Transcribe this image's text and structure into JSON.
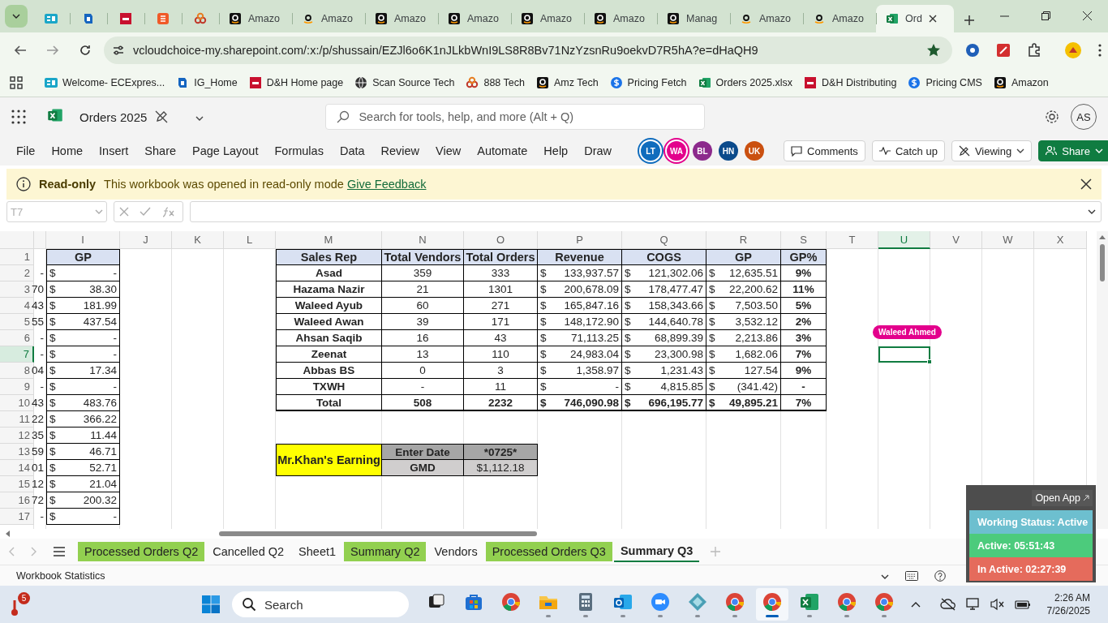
{
  "browser": {
    "tabs": [
      {
        "kind": "ec",
        "selected": false
      },
      {
        "kind": "blue",
        "selected": false
      },
      {
        "kind": "dh",
        "selected": false
      },
      {
        "kind": "s",
        "selected": false
      },
      {
        "kind": "rings",
        "selected": false
      },
      {
        "kind": "amazon-dark",
        "label": "Amazo",
        "selected": false
      },
      {
        "kind": "amazon-light",
        "label": "Amazo",
        "selected": false
      },
      {
        "kind": "amazon-dark",
        "label": "Amazo",
        "selected": false
      },
      {
        "kind": "amazon-dark",
        "label": "Amazo",
        "selected": false
      },
      {
        "kind": "amazon-dark",
        "label": "Amazo",
        "selected": false
      },
      {
        "kind": "amazon-dark",
        "label": "Amazo",
        "selected": false
      },
      {
        "kind": "amazon-dark",
        "label": "Manag",
        "selected": false
      },
      {
        "kind": "amazon-light",
        "label": "Amazo",
        "selected": false
      },
      {
        "kind": "amazon-light",
        "label": "Amazo",
        "selected": false
      },
      {
        "kind": "excel",
        "label": "Ord",
        "selected": true
      }
    ],
    "url": "vcloudchoice-my.sharepoint.com/:x:/p/shussain/EZJl6o6K1nJLkbWnI9LS8R8Bv71NzYzsnRu9oekvD7R5hA?e=dHaQH9",
    "bookmarks": [
      {
        "kind": "ec",
        "label": "Welcome- ECExpres..."
      },
      {
        "kind": "blue",
        "label": "IG_Home"
      },
      {
        "kind": "dh",
        "label": "D&H Home page"
      },
      {
        "kind": "globe",
        "label": "Scan Source Tech"
      },
      {
        "kind": "rings",
        "label": "888 Tech"
      },
      {
        "kind": "amazon-dark",
        "label": "Amz Tech"
      },
      {
        "kind": "dollar",
        "label": "Pricing Fetch"
      },
      {
        "kind": "excel",
        "label": "Orders 2025.xlsx"
      },
      {
        "kind": "dh",
        "label": "D&H Distributing"
      },
      {
        "kind": "dollar",
        "label": "Pricing CMS"
      },
      {
        "kind": "amazon-dark",
        "label": "Amazon"
      }
    ]
  },
  "excel": {
    "title": "Orders 2025",
    "search": {
      "placeholder": "Search for tools, help, and more (Alt + Q)"
    },
    "account": "AS",
    "menu": [
      "File",
      "Home",
      "Insert",
      "Share",
      "Page Layout",
      "Formulas",
      "Data",
      "Review",
      "View",
      "Automate",
      "Help",
      "Draw"
    ],
    "presence": [
      {
        "initials": "LT",
        "color": "#0f6cbd",
        "highlighted": true
      },
      {
        "initials": "WA",
        "color": "#e3008c",
        "highlighted": true
      },
      {
        "initials": "BL",
        "color": "#8c2a8c",
        "highlighted": false
      },
      {
        "initials": "HN",
        "color": "#0b4a8b",
        "highlighted": false
      },
      {
        "initials": "UK",
        "color": "#ca5010",
        "highlighted": false
      }
    ],
    "actions": [
      {
        "kind": "comments",
        "label": "Comments"
      },
      {
        "kind": "catchup",
        "label": "Catch up"
      },
      {
        "kind": "viewing",
        "label": "Viewing"
      },
      {
        "kind": "share",
        "label": "Share"
      }
    ],
    "banner": {
      "title": "Read-only",
      "message": "This workbook was opened in read-only mode",
      "link": "Give Feedback"
    },
    "name_box": "T7"
  },
  "sheet": {
    "column_headers": [
      {
        "label": "I",
        "selected": false
      },
      {
        "label": "J",
        "selected": false
      },
      {
        "label": "K",
        "selected": false
      },
      {
        "label": "L",
        "selected": false
      },
      {
        "label": "M",
        "selected": false
      },
      {
        "label": "N",
        "selected": false
      },
      {
        "label": "O",
        "selected": false
      },
      {
        "label": "P",
        "selected": false
      },
      {
        "label": "Q",
        "selected": false
      },
      {
        "label": "R",
        "selected": false
      },
      {
        "label": "S",
        "selected": false
      },
      {
        "label": "T",
        "selected": false
      },
      {
        "label": "U",
        "selected": true
      },
      {
        "label": "V",
        "selected": false
      },
      {
        "label": "W",
        "selected": false
      },
      {
        "label": "X",
        "selected": false
      }
    ],
    "row_headers": [
      {
        "label": "1",
        "selected": false
      },
      {
        "label": "2",
        "selected": false
      },
      {
        "label": "3",
        "selected": false
      },
      {
        "label": "4",
        "selected": false
      },
      {
        "label": "5",
        "selected": false
      },
      {
        "label": "6",
        "selected": false
      },
      {
        "label": "7",
        "selected": true
      },
      {
        "label": "8",
        "selected": false
      },
      {
        "label": "9",
        "selected": false
      },
      {
        "label": "10",
        "selected": false
      },
      {
        "label": "11",
        "selected": false
      },
      {
        "label": "12",
        "selected": false
      },
      {
        "label": "13",
        "selected": false
      },
      {
        "label": "14",
        "selected": false
      },
      {
        "label": "15",
        "selected": false
      },
      {
        "label": "16",
        "selected": false
      },
      {
        "label": "17",
        "selected": false
      }
    ],
    "column_h_cut": [
      "-",
      "70",
      "43",
      "55",
      "-",
      "-",
      "04",
      "-",
      "43",
      "22",
      "35",
      "59",
      "01",
      "12",
      "72",
      "-"
    ],
    "gp_column": {
      "header": "GP",
      "values": [
        {
          "symbol": "$",
          "amount": "-"
        },
        {
          "symbol": "$",
          "amount": "38.30"
        },
        {
          "symbol": "$",
          "amount": "181.99"
        },
        {
          "symbol": "$",
          "amount": "437.54"
        },
        {
          "symbol": "$",
          "amount": "-"
        },
        {
          "symbol": "$",
          "amount": "-"
        },
        {
          "symbol": "$",
          "amount": "17.34"
        },
        {
          "symbol": "$",
          "amount": "-"
        },
        {
          "symbol": "$",
          "amount": "483.76"
        },
        {
          "symbol": "$",
          "amount": "366.22"
        },
        {
          "symbol": "$",
          "amount": "11.44"
        },
        {
          "symbol": "$",
          "amount": "46.71"
        },
        {
          "symbol": "$",
          "amount": "52.71"
        },
        {
          "symbol": "$",
          "amount": "21.04"
        },
        {
          "symbol": "$",
          "amount": "200.32"
        },
        {
          "symbol": "$",
          "amount": "-"
        }
      ]
    },
    "summary_table": {
      "columns": [
        "Sales Rep",
        "Total Vendors",
        "Total Orders",
        "Revenue",
        "COGS",
        "GP",
        "GP%"
      ],
      "rows": [
        {
          "kind": "rep",
          "sales_rep": "Asad",
          "vendors": "359",
          "orders": "333",
          "revenue": {
            "symbol": "$",
            "amount": "133,937.57"
          },
          "cogs": {
            "symbol": "$",
            "amount": "121,302.06"
          },
          "gp": {
            "symbol": "$",
            "amount": "12,635.51"
          },
          "gp_pct": "9%"
        },
        {
          "kind": "rep",
          "sales_rep": "Hazama Nazir",
          "vendors": "21",
          "orders": "1301",
          "revenue": {
            "symbol": "$",
            "amount": "200,678.09"
          },
          "cogs": {
            "symbol": "$",
            "amount": "178,477.47"
          },
          "gp": {
            "symbol": "$",
            "amount": "22,200.62"
          },
          "gp_pct": "11%"
        },
        {
          "kind": "rep",
          "sales_rep": "Waleed Ayub",
          "vendors": "60",
          "orders": "271",
          "revenue": {
            "symbol": "$",
            "amount": "165,847.16"
          },
          "cogs": {
            "symbol": "$",
            "amount": "158,343.66"
          },
          "gp": {
            "symbol": "$",
            "amount": "7,503.50"
          },
          "gp_pct": "5%"
        },
        {
          "kind": "rep",
          "sales_rep": "Waleed Awan",
          "vendors": "39",
          "orders": "171",
          "revenue": {
            "symbol": "$",
            "amount": "148,172.90"
          },
          "cogs": {
            "symbol": "$",
            "amount": "144,640.78"
          },
          "gp": {
            "symbol": "$",
            "amount": "3,532.12"
          },
          "gp_pct": "2%"
        },
        {
          "kind": "rep",
          "sales_rep": "Ahsan Saqib",
          "vendors": "16",
          "orders": "43",
          "revenue": {
            "symbol": "$",
            "amount": "71,113.25"
          },
          "cogs": {
            "symbol": "$",
            "amount": "68,899.39"
          },
          "gp": {
            "symbol": "$",
            "amount": "2,213.86"
          },
          "gp_pct": "3%"
        },
        {
          "kind": "rep",
          "sales_rep": "Zeenat",
          "vendors": "13",
          "orders": "110",
          "revenue": {
            "symbol": "$",
            "amount": "24,983.04"
          },
          "cogs": {
            "symbol": "$",
            "amount": "23,300.98"
          },
          "gp": {
            "symbol": "$",
            "amount": "1,682.06"
          },
          "gp_pct": "7%"
        },
        {
          "kind": "rep",
          "sales_rep": "Abbas BS",
          "vendors": "0",
          "orders": "3",
          "revenue": {
            "symbol": "$",
            "amount": "1,358.97"
          },
          "cogs": {
            "symbol": "$",
            "amount": "1,231.43"
          },
          "gp": {
            "symbol": "$",
            "amount": "127.54"
          },
          "gp_pct": "9%"
        },
        {
          "kind": "rep",
          "sales_rep": "TXWH",
          "vendors": "-",
          "orders": "11",
          "revenue": {
            "symbol": "$",
            "amount": "-"
          },
          "cogs": {
            "symbol": "$",
            "amount": "4,815.85"
          },
          "gp": {
            "symbol": "$",
            "amount": "(341.42)"
          },
          "gp_pct": "-"
        },
        {
          "kind": "total",
          "sales_rep": "Total",
          "vendors": "508",
          "orders": "2232",
          "revenue": {
            "symbol": "$",
            "amount": "746,090.98"
          },
          "cogs": {
            "symbol": "$",
            "amount": "696,195.77"
          },
          "gp": {
            "symbol": "$",
            "amount": "49,895.21"
          },
          "gp_pct": "7%"
        }
      ]
    },
    "earning_box": {
      "title": "Mr.Khan's Earning",
      "rows": [
        {
          "label": "Enter Date",
          "value": "*0725*"
        },
        {
          "label": "GMD",
          "value": "$1,112.18"
        }
      ]
    },
    "presence_tag": {
      "name": "Waleed Ahmed",
      "color": "#e3008c"
    }
  },
  "sheet_tabs": [
    {
      "label": "Processed Orders Q2",
      "color": "#92d050",
      "selected": false
    },
    {
      "label": "Cancelled Q2",
      "selected": false
    },
    {
      "label": "Sheet1",
      "selected": false
    },
    {
      "label": "Summary Q2",
      "color": "#92d050",
      "selected": false
    },
    {
      "label": "Vendors",
      "selected": false
    },
    {
      "label": "Processed Orders Q3",
      "color": "#92d050",
      "selected": false
    },
    {
      "label": "Summary Q3",
      "selected": true
    }
  ],
  "status_bar": {
    "label": "Workbook Statistics"
  },
  "tracker": {
    "open_app": "Open App",
    "rows": [
      {
        "label": "Working Status: Active",
        "color": "#6dbfcf"
      },
      {
        "label": "Active: 05:51:43",
        "color": "#4ccb7c"
      },
      {
        "label": "In Active: 02:27:39",
        "color": "#e56b5c"
      }
    ]
  },
  "taskbar": {
    "notification_count": "5",
    "search": {
      "placeholder": "Search"
    },
    "apps": [
      {
        "kind": "task-view",
        "running": false,
        "selected": false
      },
      {
        "kind": "store",
        "running": false,
        "selected": false
      },
      {
        "kind": "chrome",
        "running": false,
        "selected": false
      },
      {
        "kind": "folder",
        "running": true,
        "selected": false
      },
      {
        "kind": "calculator",
        "running": true,
        "selected": false
      },
      {
        "kind": "outlook",
        "running": true,
        "selected": false
      },
      {
        "kind": "zoom",
        "running": true,
        "selected": false
      },
      {
        "kind": "diamond",
        "running": true,
        "selected": false
      },
      {
        "kind": "chrome",
        "running": true,
        "selected": false
      },
      {
        "kind": "chrome",
        "running": true,
        "selected": true
      },
      {
        "kind": "excel",
        "running": true,
        "selected": false
      },
      {
        "kind": "chrome",
        "running": true,
        "selected": false
      },
      {
        "kind": "chrome",
        "running": true,
        "selected": false
      }
    ],
    "time": "2:26 AM",
    "date": "7/26/2025"
  }
}
